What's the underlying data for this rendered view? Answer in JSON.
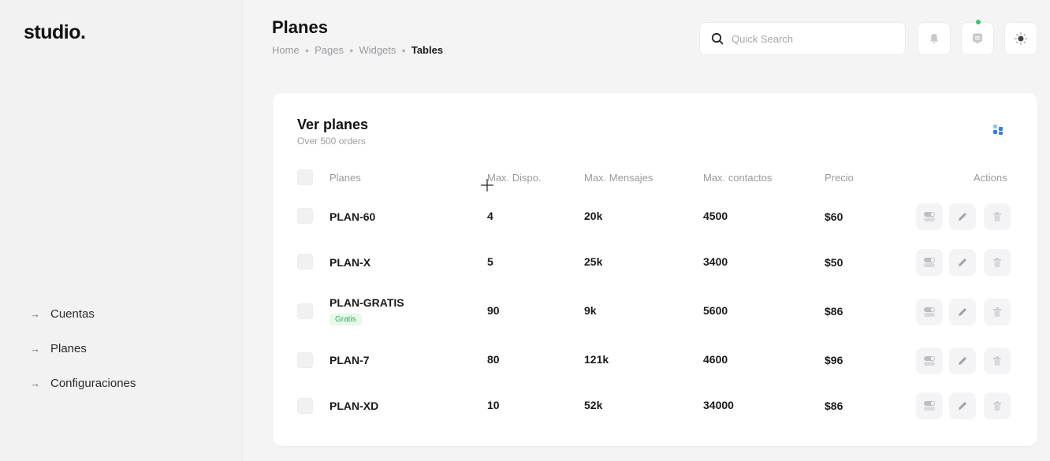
{
  "sidebar": {
    "logo": "studio.",
    "items": [
      {
        "label": "Cuentas"
      },
      {
        "label": "Planes"
      },
      {
        "label": "Configuraciones"
      }
    ]
  },
  "header": {
    "title": "Planes",
    "breadcrumb": [
      "Home",
      "Pages",
      "Widgets",
      "Tables"
    ],
    "search_placeholder": "Quick Search",
    "icons": [
      "bell-icon",
      "chat-icon",
      "sun-icon"
    ],
    "notification_color": "#3ec46d"
  },
  "card": {
    "title": "Ver planes",
    "subtitle": "Over 500 orders",
    "columns": [
      "Planes",
      "Max. Dispo.",
      "Max. Mensajes",
      "Max. contactos",
      "Precio",
      "Actions"
    ],
    "rows": [
      {
        "name": "PLAN-60",
        "badge": "",
        "dispo": "4",
        "mensajes": "20k",
        "contactos": "4500",
        "precio": "$60"
      },
      {
        "name": "PLAN-X",
        "badge": "",
        "dispo": "5",
        "mensajes": "25k",
        "contactos": "3400",
        "precio": "$50"
      },
      {
        "name": "PLAN-GRATIS",
        "badge": "Gratis",
        "dispo": "90",
        "mensajes": "9k",
        "contactos": "5600",
        "precio": "$86"
      },
      {
        "name": "PLAN-7",
        "badge": "",
        "dispo": "80",
        "mensajes": "121k",
        "contactos": "4600",
        "precio": "$96"
      },
      {
        "name": "PLAN-XD",
        "badge": "",
        "dispo": "10",
        "mensajes": "52k",
        "contactos": "34000",
        "precio": "$86"
      }
    ],
    "row_actions": [
      "toggle-icon",
      "pencil-icon",
      "trash-icon"
    ],
    "accent_color": "#2f7bf5",
    "badge_color": "#3aa85a"
  }
}
